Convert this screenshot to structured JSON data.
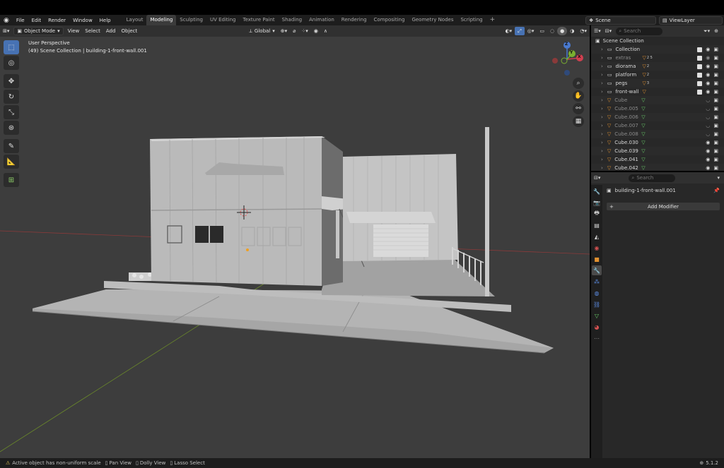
{
  "menu": [
    "File",
    "Edit",
    "Render",
    "Window",
    "Help"
  ],
  "workspaces": [
    "Layout",
    "Modeling",
    "Sculpting",
    "UV Editing",
    "Texture Paint",
    "Shading",
    "Animation",
    "Rendering",
    "Compositing",
    "Geometry Nodes",
    "Scripting"
  ],
  "active_workspace": "Modeling",
  "scene": "Scene",
  "view_layer": "ViewLayer",
  "viewport_header": {
    "mode": "Object Mode",
    "view": "View",
    "select": "Select",
    "add": "Add",
    "object": "Object",
    "transform_orientation": "Global"
  },
  "viewport_overlay": {
    "perspective": "User Perspective",
    "collection_path": "(49) Scene Collection | building-1-front-wall.001"
  },
  "gizmo": {
    "x": "X",
    "y": "Y",
    "z": "Z"
  },
  "outliner": {
    "search_placeholder": "Search",
    "root": "Scene Collection",
    "rows": [
      {
        "name": "Collection",
        "type": "collection",
        "dim": false,
        "counts": ""
      },
      {
        "name": "extras",
        "type": "collection",
        "dim": true,
        "counts": "2 5"
      },
      {
        "name": "diorama",
        "type": "collection",
        "dim": false,
        "counts": "2"
      },
      {
        "name": "platform",
        "type": "collection",
        "dim": false,
        "counts": "2"
      },
      {
        "name": "pegs",
        "type": "collection",
        "dim": false,
        "counts": "3"
      },
      {
        "name": "front-wall",
        "type": "collection",
        "dim": false,
        "counts": ""
      },
      {
        "name": "Cube",
        "type": "mesh",
        "dim": true,
        "counts": ""
      },
      {
        "name": "Cube.005",
        "type": "mesh",
        "dim": true,
        "counts": ""
      },
      {
        "name": "Cube.006",
        "type": "mesh",
        "dim": true,
        "counts": ""
      },
      {
        "name": "Cube.007",
        "type": "mesh",
        "dim": true,
        "counts": ""
      },
      {
        "name": "Cube.008",
        "type": "mesh",
        "dim": true,
        "counts": ""
      },
      {
        "name": "Cube.030",
        "type": "mesh",
        "dim": false,
        "counts": ""
      },
      {
        "name": "Cube.039",
        "type": "mesh",
        "dim": false,
        "counts": ""
      },
      {
        "name": "Cube.041",
        "type": "mesh",
        "dim": false,
        "counts": ""
      },
      {
        "name": "Cube.042",
        "type": "mesh",
        "dim": false,
        "counts": ""
      }
    ]
  },
  "properties": {
    "search_placeholder": "Search",
    "object_name": "building-1-front-wall.001",
    "add_modifier": "Add Modifier"
  },
  "status": {
    "warning": "Active object has non-uniform scale",
    "pan": "Pan View",
    "dolly": "Dolly View",
    "lasso": "Lasso Select",
    "version": "5.1.2"
  }
}
